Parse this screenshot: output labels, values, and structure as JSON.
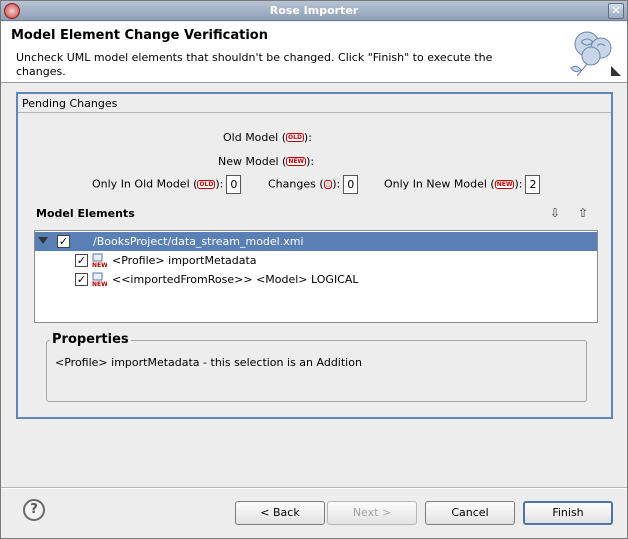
{
  "window": {
    "title": "Rose Importer"
  },
  "header": {
    "title": "Model Element Change Verification",
    "description": "Uncheck UML model elements that shouldn't be changed. Click \"Finish\" to execute the changes."
  },
  "pending": {
    "group_label": "Pending Changes",
    "old_model_label": "Old Model (",
    "old_model_suffix": "):",
    "new_model_label": "New Model (",
    "new_model_suffix": "):",
    "only_in_old_label": "Only In  Old Model (",
    "only_in_old_value": "0",
    "changes_label": "Changes (",
    "changes_value": "0",
    "only_in_new_label": "Only In  New Model (",
    "only_in_new_value": "2",
    "badge_old": "OLD",
    "badge_new": "NEW",
    "badge_change": "△",
    "suffix": "):"
  },
  "model_elements": {
    "label": "Model Elements",
    "move_down_icon": "⇩",
    "move_up_icon": "⇧",
    "rows": [
      {
        "text": "/BooksProject/data_stream_model.xmi",
        "checked": true,
        "selected": true
      },
      {
        "text": "<Profile> importMetadata",
        "checked": true,
        "icon": "NEW"
      },
      {
        "text": "<<importedFromRose>> <Model> LOGICAL",
        "checked": true,
        "icon": "NEW"
      }
    ]
  },
  "properties": {
    "title": "Properties",
    "value": "<Profile> importMetadata - this selection is an Addition"
  },
  "buttons": {
    "help": "?",
    "back": "< Back",
    "next": "Next >",
    "cancel": "Cancel",
    "finish": "Finish"
  },
  "colors": {
    "accent": "#5f86b4",
    "selection": "#5a7fb5",
    "badge": "#c00000"
  }
}
